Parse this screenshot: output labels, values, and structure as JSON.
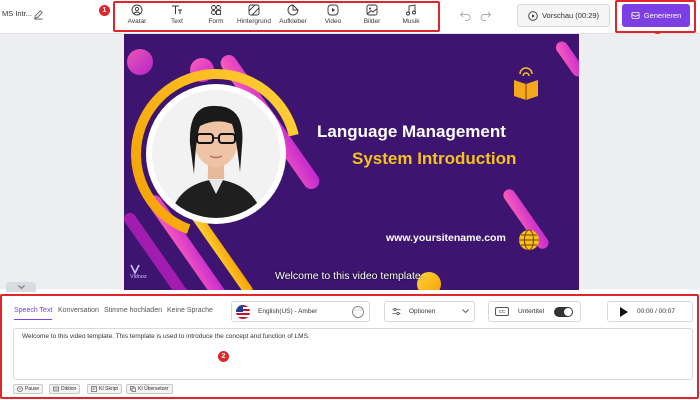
{
  "project": {
    "name": "MS Intr..."
  },
  "markers": {
    "one": "1",
    "two": "2",
    "three": "3"
  },
  "toolbar": {
    "tools": [
      {
        "label": "Avatar",
        "icon": "avatar-icon"
      },
      {
        "label": "Text",
        "icon": "text-icon"
      },
      {
        "label": "Form",
        "icon": "shapes-icon"
      },
      {
        "label": "Hintergrund",
        "icon": "background-icon"
      },
      {
        "label": "Aufkleber",
        "icon": "sticker-icon"
      },
      {
        "label": "Video",
        "icon": "video-icon"
      },
      {
        "label": "Bilder",
        "icon": "image-icon"
      },
      {
        "label": "Musik",
        "icon": "music-icon"
      }
    ],
    "preview_label": "Vorschau (00:29)",
    "generate_label": "Generieren"
  },
  "slide": {
    "headline_line1": "Language Management",
    "headline_line2": "System Introduction",
    "website": "www.yoursitename.com",
    "caption": "Welcome to this video template.",
    "brand": "Vidnoz"
  },
  "editor": {
    "tabs": [
      "Speech Text",
      "Konversation",
      "Stimme hochladen",
      "Keine Sprache"
    ],
    "voice": "English(US) - Amber",
    "options_label": "Optionen",
    "subtitle_label": "Untertitel",
    "subtitle_on": true,
    "time": "00:00 / 00:07",
    "script_text": "Welcome to this video template. This template is used to introduce the concept and function of LMS.",
    "actions": [
      "Pause",
      "Diktion",
      "KI Skript",
      "KI Übersetzer"
    ]
  },
  "colors": {
    "accent": "#7b3fe4",
    "highlight": "#e0262b",
    "slide_bg": "#3d1570",
    "slide_yellow": "#f6c21c"
  }
}
